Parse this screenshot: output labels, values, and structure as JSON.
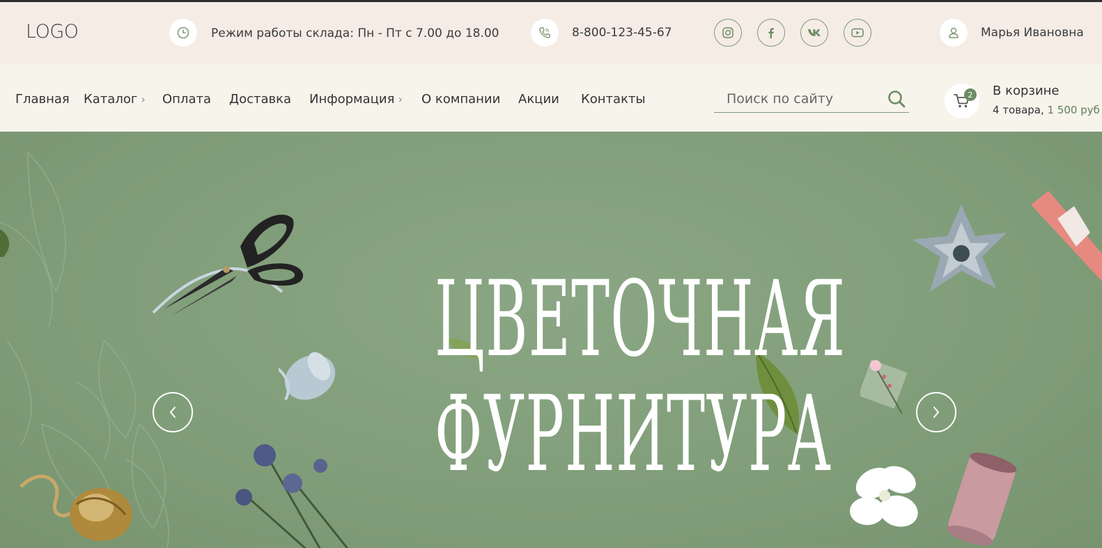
{
  "header": {
    "logo": "LOGO",
    "hours": "Режим работы склада: Пн - Пт с 7.00 до 18.00",
    "phone": "8-800-123-45-67",
    "user_name": "Марья Ивановна",
    "icons": [
      "clock-icon",
      "phone-icon",
      "instagram-icon",
      "facebook-icon",
      "vk-icon",
      "youtube-icon",
      "user-icon"
    ]
  },
  "nav": {
    "items": [
      {
        "label": "Главная",
        "has_submenu": false
      },
      {
        "label": "Каталог",
        "has_submenu": true
      },
      {
        "label": "Оплата",
        "has_submenu": false
      },
      {
        "label": "Доставка",
        "has_submenu": false
      },
      {
        "label": "Информация",
        "has_submenu": true
      },
      {
        "label": "О компании",
        "has_submenu": false
      },
      {
        "label": "Акции",
        "has_submenu": false
      },
      {
        "label": "Контакты",
        "has_submenu": false
      }
    ],
    "search_placeholder": "Поиск по сайту"
  },
  "cart": {
    "count": "2",
    "title": "В корзине",
    "items_text": "4 товара, ",
    "price": "1 500 руб"
  },
  "hero": {
    "line1": "ЦВЕТОЧНАЯ",
    "line2": "ФУРНИТУРА"
  },
  "colors": {
    "accent": "#6d8c64",
    "topbar_bg": "#f5ece6",
    "navbar_bg": "#f7f4ec",
    "hero_bg": "#819e7a"
  }
}
